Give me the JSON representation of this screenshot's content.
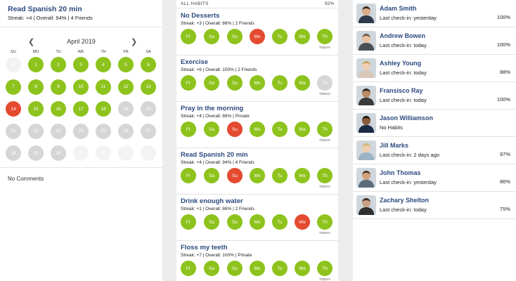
{
  "colors": {
    "accent": "#2c4a7e",
    "done": "#8dc31c",
    "missed": "#e44a2f",
    "skipped": "#d6d6d6"
  },
  "detail": {
    "title": "Read Spanish 20 min",
    "stats": "Streak: +4  |  Overall: 94%  |  4 Friends",
    "calendar": {
      "month": "April 2019",
      "prev_icon": "chevron-left-icon",
      "next_icon": "chevron-right-icon",
      "weekdays": [
        "SU",
        "MO",
        "TU",
        "WE",
        "TH",
        "FR",
        "SA"
      ],
      "weeks": [
        [
          {
            "d": "31",
            "s": "faint"
          },
          {
            "d": "1",
            "s": "green"
          },
          {
            "d": "2",
            "s": "green"
          },
          {
            "d": "3",
            "s": "green"
          },
          {
            "d": "4",
            "s": "green"
          },
          {
            "d": "5",
            "s": "green"
          },
          {
            "d": "6",
            "s": "green"
          }
        ],
        [
          {
            "d": "7",
            "s": "green"
          },
          {
            "d": "8",
            "s": "green"
          },
          {
            "d": "9",
            "s": "green"
          },
          {
            "d": "10",
            "s": "green"
          },
          {
            "d": "11",
            "s": "green"
          },
          {
            "d": "12",
            "s": "green"
          },
          {
            "d": "13",
            "s": "green"
          }
        ],
        [
          {
            "d": "14",
            "s": "red"
          },
          {
            "d": "15",
            "s": "green"
          },
          {
            "d": "16",
            "s": "green"
          },
          {
            "d": "17",
            "s": "green"
          },
          {
            "d": "18",
            "s": "green"
          },
          {
            "d": "19",
            "s": "gray"
          },
          {
            "d": "20",
            "s": "gray"
          }
        ],
        [
          {
            "d": "21",
            "s": "gray"
          },
          {
            "d": "22",
            "s": "gray"
          },
          {
            "d": "23",
            "s": "gray"
          },
          {
            "d": "24",
            "s": "gray"
          },
          {
            "d": "25",
            "s": "gray"
          },
          {
            "d": "26",
            "s": "gray"
          },
          {
            "d": "27",
            "s": "gray"
          }
        ],
        [
          {
            "d": "28",
            "s": "gray"
          },
          {
            "d": "29",
            "s": "gray"
          },
          {
            "d": "30",
            "s": "gray"
          },
          {
            "d": "1",
            "s": "faint"
          },
          {
            "d": "2",
            "s": "faint"
          },
          {
            "d": "3",
            "s": "faint"
          },
          {
            "d": "4",
            "s": "faint"
          }
        ]
      ]
    },
    "comments": "No Comments"
  },
  "habits_list": {
    "header": "ALL HABITS",
    "percent": "92%",
    "today_label": "TODAY",
    "habits": [
      {
        "name": "No Desserts",
        "stats": "Streak: +3  |  Overall: 86%  |  2 Friends",
        "days": [
          {
            "l": "Fr",
            "s": "green"
          },
          {
            "l": "Sa",
            "s": "green"
          },
          {
            "l": "Su",
            "s": "green"
          },
          {
            "l": "Mo",
            "s": "red"
          },
          {
            "l": "Tu",
            "s": "green"
          },
          {
            "l": "We",
            "s": "green"
          },
          {
            "l": "Th",
            "s": "green"
          }
        ]
      },
      {
        "name": "Exercise",
        "stats": "Streak: +6  |  Overall: 100%  |  2 Friends",
        "days": [
          {
            "l": "Fr",
            "s": "green"
          },
          {
            "l": "Sa",
            "s": "green"
          },
          {
            "l": "Su",
            "s": "green"
          },
          {
            "l": "Mo",
            "s": "green"
          },
          {
            "l": "Tu",
            "s": "green"
          },
          {
            "l": "We",
            "s": "green"
          },
          {
            "l": "Th",
            "s": "gray"
          }
        ]
      },
      {
        "name": "Pray in the morning",
        "stats": "Streak: +4  |  Overall: 86%  |  Private",
        "days": [
          {
            "l": "Fr",
            "s": "green"
          },
          {
            "l": "Sa",
            "s": "green"
          },
          {
            "l": "Su",
            "s": "red"
          },
          {
            "l": "Mo",
            "s": "green"
          },
          {
            "l": "Tu",
            "s": "green"
          },
          {
            "l": "We",
            "s": "green"
          },
          {
            "l": "Th",
            "s": "green"
          }
        ]
      },
      {
        "name": "Read Spanish 20 min",
        "stats": "Streak: +4  |  Overall: 94%  |  4 Friends",
        "days": [
          {
            "l": "Fr",
            "s": "green"
          },
          {
            "l": "Sa",
            "s": "green"
          },
          {
            "l": "Su",
            "s": "red"
          },
          {
            "l": "Mo",
            "s": "green"
          },
          {
            "l": "Tu",
            "s": "green"
          },
          {
            "l": "We",
            "s": "green"
          },
          {
            "l": "Th",
            "s": "green"
          }
        ]
      },
      {
        "name": "Drink enough water",
        "stats": "Streak: +1  |  Overall: 86%  |  2 Friends",
        "days": [
          {
            "l": "Fr",
            "s": "green"
          },
          {
            "l": "Sa",
            "s": "green"
          },
          {
            "l": "Su",
            "s": "green"
          },
          {
            "l": "Mo",
            "s": "green"
          },
          {
            "l": "Tu",
            "s": "green"
          },
          {
            "l": "We",
            "s": "red"
          },
          {
            "l": "Th",
            "s": "green"
          }
        ]
      },
      {
        "name": "Floss my teeth",
        "stats": "Streak: +7  |  Overall: 100%  |  Private",
        "days": [
          {
            "l": "Fr",
            "s": "green"
          },
          {
            "l": "Sa",
            "s": "green"
          },
          {
            "l": "Su",
            "s": "green"
          },
          {
            "l": "Mo",
            "s": "green"
          },
          {
            "l": "Tu",
            "s": "green"
          },
          {
            "l": "We",
            "s": "green"
          },
          {
            "l": "Th",
            "s": "green"
          }
        ]
      }
    ]
  },
  "friends": [
    {
      "name": "Adam Smith",
      "checkin": "Last check-in: yesterday",
      "pct": "100%",
      "skin": "#d9ad8a",
      "hair": "#3a2a1e",
      "shirt": "#2d3b4c"
    },
    {
      "name": "Andrew Bowen",
      "checkin": "Last check-in: today",
      "pct": "100%",
      "skin": "#e6c2a3",
      "hair": "#6b5a4a",
      "shirt": "#4a4f55"
    },
    {
      "name": "Ashley Young",
      "checkin": "Last check-in: today",
      "pct": "88%",
      "skin": "#f0cfb5",
      "hair": "#c9a463",
      "shirt": "#d7c7b8"
    },
    {
      "name": "Fransisco Ray",
      "checkin": "Last check-in: today",
      "pct": "100%",
      "skin": "#b98a65",
      "hair": "#2a1f18",
      "shirt": "#3b3b3b"
    },
    {
      "name": "Jason Williamson",
      "checkin": "No Habits",
      "pct": "",
      "skin": "#8a5a3c",
      "hair": "#1d1510",
      "shirt": "#1a2a44"
    },
    {
      "name": "Jill Marks",
      "checkin": "Last check-in: 2 days ago",
      "pct": "97%",
      "skin": "#efcdb0",
      "hair": "#d8b67a",
      "shirt": "#9bb3c4"
    },
    {
      "name": "John Thomas",
      "checkin": "Last check-in: yesterday",
      "pct": "86%",
      "skin": "#d1a27d",
      "hair": "#4a3826",
      "shirt": "#5a6a7a"
    },
    {
      "name": "Zachary Shelton",
      "checkin": "Last check-in: today",
      "pct": "75%",
      "skin": "#caa084",
      "hair": "#3d2c20",
      "shirt": "#2f2f2f"
    }
  ]
}
